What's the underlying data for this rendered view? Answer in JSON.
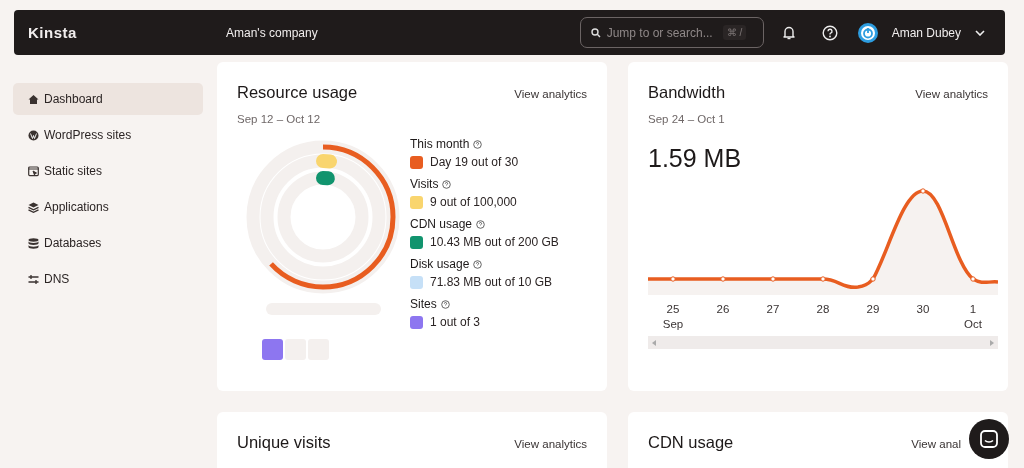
{
  "topbar": {
    "logo": "Kinsta",
    "company": "Aman's company",
    "search": {
      "placeholder": "Jump to or search...",
      "shortcut": "⌘ /"
    },
    "user": "Aman Dubey"
  },
  "sidebar": {
    "items": [
      {
        "label": "Dashboard",
        "selected": true
      },
      {
        "label": "WordPress sites",
        "selected": false
      },
      {
        "label": "Static sites",
        "selected": false
      },
      {
        "label": "Applications",
        "selected": false
      },
      {
        "label": "Databases",
        "selected": false
      },
      {
        "label": "DNS",
        "selected": false
      }
    ]
  },
  "resource_usage": {
    "title": "Resource usage",
    "link": "View analytics",
    "range": "Sep 12 – Oct 12",
    "metrics": [
      {
        "label": "This month",
        "value": "Day 19 out of 30",
        "color": "#e85d20",
        "kind": "ring",
        "level": 0.633
      },
      {
        "label": "Visits",
        "value": "9 out of 100,000",
        "color": "#f9d56e",
        "kind": "ring"
      },
      {
        "label": "CDN usage",
        "value": "10.43 MB out of 200 GB",
        "color": "#11946e",
        "kind": "ring"
      },
      {
        "label": "Disk usage",
        "value": "71.83 MB out of 10 GB",
        "color": "#c6e0f7",
        "kind": "bar"
      },
      {
        "label": "Sites",
        "value": "1 out of 3",
        "color": "#8d76f0",
        "kind": "blocks",
        "level": 0.333
      }
    ]
  },
  "bandwidth": {
    "title": "Bandwidth",
    "link": "View analytics",
    "range": "Sep 24 – Oct 1",
    "total": "1.59 MB",
    "x_labels": [
      {
        "day": "25",
        "month": "Sep"
      },
      {
        "day": "26"
      },
      {
        "day": "27"
      },
      {
        "day": "28"
      },
      {
        "day": "29"
      },
      {
        "day": "30"
      },
      {
        "day": "1",
        "month": "Oct"
      }
    ]
  },
  "bottom_cards": [
    {
      "title": "Unique visits",
      "link": "View analytics"
    },
    {
      "title": "CDN usage",
      "link": "View anal"
    }
  ]
}
